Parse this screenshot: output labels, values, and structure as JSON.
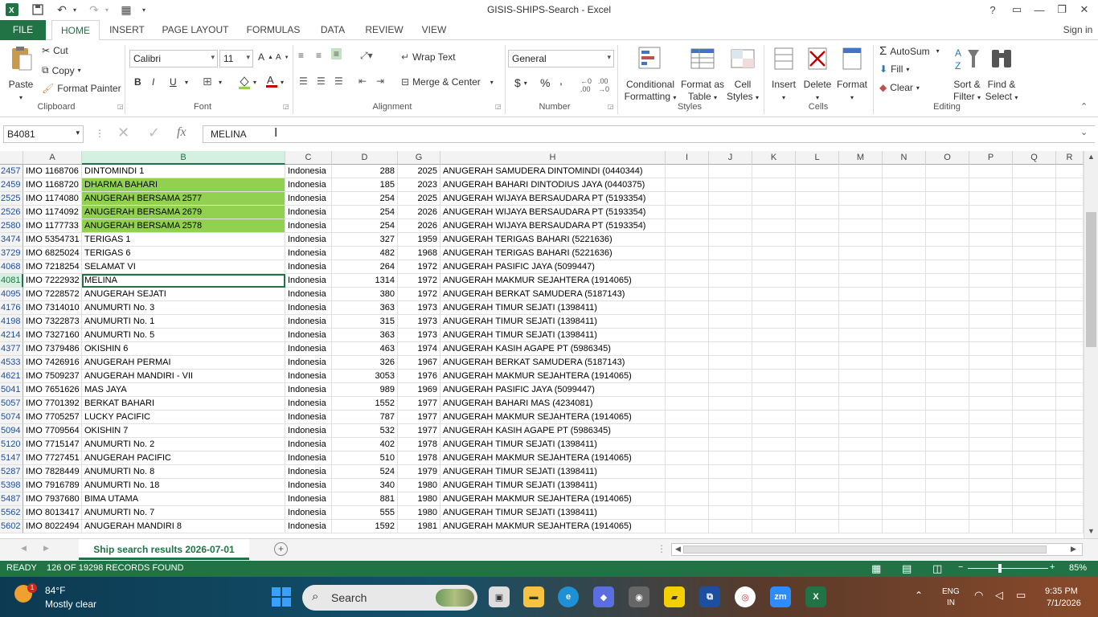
{
  "window": {
    "title": "GISIS-SHIPS-Search - Excel",
    "sign_in": "Sign in",
    "help": "?"
  },
  "ribbon_tabs": [
    "FILE",
    "HOME",
    "INSERT",
    "PAGE LAYOUT",
    "FORMULAS",
    "DATA",
    "REVIEW",
    "VIEW"
  ],
  "ribbon": {
    "clipboard": {
      "paste": "Paste",
      "cut": "Cut",
      "copy": "Copy",
      "format_painter": "Format Painter",
      "label": "Clipboard"
    },
    "font": {
      "name": "Calibri",
      "size": "11",
      "bold": "B",
      "italic": "I",
      "underline": "U",
      "label": "Font"
    },
    "alignment": {
      "wrap_text": "Wrap Text",
      "merge_center": "Merge & Center",
      "label": "Alignment"
    },
    "number": {
      "format": "General",
      "currency": "$",
      "percent": "%",
      "comma": ",",
      "label": "Number"
    },
    "styles": {
      "conditional": "Conditional",
      "conditional2": "Formatting",
      "format_as": "Format as",
      "format_as2": "Table",
      "cell": "Cell",
      "cell2": "Styles",
      "label": "Styles"
    },
    "cells": {
      "insert": "Insert",
      "delete": "Delete",
      "format": "Format",
      "label": "Cells"
    },
    "editing": {
      "autosum": "AutoSum",
      "fill": "Fill",
      "clear": "Clear",
      "sort": "Sort &",
      "sort2": "Filter",
      "find": "Find &",
      "find2": "Select",
      "label": "Editing"
    }
  },
  "formula_bar": {
    "name_box": "B4081",
    "fx": "fx",
    "value": "MELINA"
  },
  "columns": [
    "A",
    "B",
    "C",
    "D",
    "G",
    "H",
    "I",
    "J",
    "K",
    "L",
    "M",
    "N",
    "O",
    "P",
    "Q",
    "R"
  ],
  "rows": [
    {
      "num": "2457",
      "a": "IMO 1168706",
      "b": "DINTOMINDI 1",
      "c": "Indonesia",
      "d": "288",
      "g": "2025",
      "h": "ANUGERAH SAMUDERA DINTOMINDI (0440344)",
      "hl": false
    },
    {
      "num": "2459",
      "a": "IMO 1168720",
      "b": "DHARMA BAHARI",
      "c": "Indonesia",
      "d": "185",
      "g": "2023",
      "h": "ANUGERAH BAHARI DINTODIUS JAYA (0440375)",
      "hl": true
    },
    {
      "num": "2525",
      "a": "IMO 1174080",
      "b": "ANUGERAH BERSAMA 2577",
      "c": "Indonesia",
      "d": "254",
      "g": "2025",
      "h": "ANUGERAH WIJAYA BERSAUDARA PT (5193354)",
      "hl": true
    },
    {
      "num": "2526",
      "a": "IMO 1174092",
      "b": "ANUGERAH BERSAMA 2679",
      "c": "Indonesia",
      "d": "254",
      "g": "2026",
      "h": "ANUGERAH WIJAYA BERSAUDARA PT (5193354)",
      "hl": true
    },
    {
      "num": "2580",
      "a": "IMO 1177733",
      "b": "ANUGERAH BERSAMA 2578",
      "c": "Indonesia",
      "d": "254",
      "g": "2026",
      "h": "ANUGERAH WIJAYA BERSAUDARA PT (5193354)",
      "hl": true
    },
    {
      "num": "3474",
      "a": "IMO 5354731",
      "b": "TERIGAS 1",
      "c": "Indonesia",
      "d": "327",
      "g": "1959",
      "h": "ANUGERAH TERIGAS BAHARI (5221636)",
      "hl": false
    },
    {
      "num": "3729",
      "a": "IMO 6825024",
      "b": "TERIGAS 6",
      "c": "Indonesia",
      "d": "482",
      "g": "1968",
      "h": "ANUGERAH TERIGAS BAHARI (5221636)",
      "hl": false
    },
    {
      "num": "4068",
      "a": "IMO 7218254",
      "b": "SELAMAT VI",
      "c": "Indonesia",
      "d": "264",
      "g": "1972",
      "h": "ANUGERAH PASIFIC JAYA (5099447)",
      "hl": false
    },
    {
      "num": "4081",
      "a": "IMO 7222932",
      "b": "MELINA",
      "c": "Indonesia",
      "d": "1314",
      "g": "1972",
      "h": "ANUGERAH MAKMUR SEJAHTERA (1914065)",
      "hl": false,
      "active": true
    },
    {
      "num": "4095",
      "a": "IMO 7228572",
      "b": "ANUGERAH SEJATI",
      "c": "Indonesia",
      "d": "380",
      "g": "1972",
      "h": "ANUGERAH BERKAT SAMUDERA (5187143)",
      "hl": false
    },
    {
      "num": "4176",
      "a": "IMO 7314010",
      "b": "ANUMURTI No. 3",
      "c": "Indonesia",
      "d": "363",
      "g": "1973",
      "h": "ANUGERAH TIMUR SEJATI (1398411)",
      "hl": false
    },
    {
      "num": "4198",
      "a": "IMO 7322873",
      "b": "ANUMURTI No. 1",
      "c": "Indonesia",
      "d": "315",
      "g": "1973",
      "h": "ANUGERAH TIMUR SEJATI (1398411)",
      "hl": false
    },
    {
      "num": "4214",
      "a": "IMO 7327160",
      "b": "ANUMURTI No. 5",
      "c": "Indonesia",
      "d": "363",
      "g": "1973",
      "h": "ANUGERAH TIMUR SEJATI (1398411)",
      "hl": false
    },
    {
      "num": "4377",
      "a": "IMO 7379486",
      "b": "OKISHIN 6",
      "c": "Indonesia",
      "d": "463",
      "g": "1974",
      "h": "ANUGERAH KASIH AGAPE PT (5986345)",
      "hl": false
    },
    {
      "num": "4533",
      "a": "IMO 7426916",
      "b": "ANUGERAH PERMAI",
      "c": "Indonesia",
      "d": "326",
      "g": "1967",
      "h": "ANUGERAH BERKAT SAMUDERA (5187143)",
      "hl": false
    },
    {
      "num": "4621",
      "a": "IMO 7509237",
      "b": "ANUGERAH MANDIRI - VII",
      "c": "Indonesia",
      "d": "3053",
      "g": "1976",
      "h": "ANUGERAH MAKMUR SEJAHTERA (1914065)",
      "hl": false
    },
    {
      "num": "5041",
      "a": "IMO 7651626",
      "b": "MAS JAYA",
      "c": "Indonesia",
      "d": "989",
      "g": "1969",
      "h": "ANUGERAH PASIFIC JAYA (5099447)",
      "hl": false
    },
    {
      "num": "5057",
      "a": "IMO 7701392",
      "b": "BERKAT BAHARI",
      "c": "Indonesia",
      "d": "1552",
      "g": "1977",
      "h": "ANUGERAH BAHARI MAS (4234081)",
      "hl": false
    },
    {
      "num": "5074",
      "a": "IMO 7705257",
      "b": "LUCKY PACIFIC",
      "c": "Indonesia",
      "d": "787",
      "g": "1977",
      "h": "ANUGERAH MAKMUR SEJAHTERA (1914065)",
      "hl": false
    },
    {
      "num": "5094",
      "a": "IMO 7709564",
      "b": "OKISHIN 7",
      "c": "Indonesia",
      "d": "532",
      "g": "1977",
      "h": "ANUGERAH KASIH AGAPE PT (5986345)",
      "hl": false
    },
    {
      "num": "5120",
      "a": "IMO 7715147",
      "b": "ANUMURTI No. 2",
      "c": "Indonesia",
      "d": "402",
      "g": "1978",
      "h": "ANUGERAH TIMUR SEJATI (1398411)",
      "hl": false
    },
    {
      "num": "5147",
      "a": "IMO 7727451",
      "b": "ANUGERAH PACIFIC",
      "c": "Indonesia",
      "d": "510",
      "g": "1978",
      "h": "ANUGERAH MAKMUR SEJAHTERA (1914065)",
      "hl": false
    },
    {
      "num": "5287",
      "a": "IMO 7828449",
      "b": "ANUMURTI No. 8",
      "c": "Indonesia",
      "d": "524",
      "g": "1979",
      "h": "ANUGERAH TIMUR SEJATI (1398411)",
      "hl": false
    },
    {
      "num": "5398",
      "a": "IMO 7916789",
      "b": "ANUMURTI No. 18",
      "c": "Indonesia",
      "d": "340",
      "g": "1980",
      "h": "ANUGERAH TIMUR SEJATI (1398411)",
      "hl": false
    },
    {
      "num": "5487",
      "a": "IMO 7937680",
      "b": "BIMA UTAMA",
      "c": "Indonesia",
      "d": "881",
      "g": "1980",
      "h": "ANUGERAH MAKMUR SEJAHTERA (1914065)",
      "hl": false
    },
    {
      "num": "5562",
      "a": "IMO 8013417",
      "b": "ANUMURTI No. 7",
      "c": "Indonesia",
      "d": "555",
      "g": "1980",
      "h": "ANUGERAH TIMUR SEJATI (1398411)",
      "hl": false
    },
    {
      "num": "5602",
      "a": "IMO 8022494",
      "b": "ANUGERAH MANDIRI 8",
      "c": "Indonesia",
      "d": "1592",
      "g": "1981",
      "h": "ANUGERAH MAKMUR SEJAHTERA (1914065)",
      "hl": false
    }
  ],
  "sheet_tab": "Ship search results 2026-07-01",
  "status": {
    "ready": "READY",
    "records": "126 OF 19298 RECORDS FOUND",
    "zoom": "85%"
  },
  "taskbar": {
    "weather_temp": "84°F",
    "weather_desc": "Mostly clear",
    "search": "Search",
    "lang": "ENG",
    "lang2": "IN",
    "time": "9:35 PM",
    "date": "7/1/2026",
    "badge": "1"
  },
  "colors": {
    "excel_green": "#217346",
    "highlight": "#92d050"
  }
}
